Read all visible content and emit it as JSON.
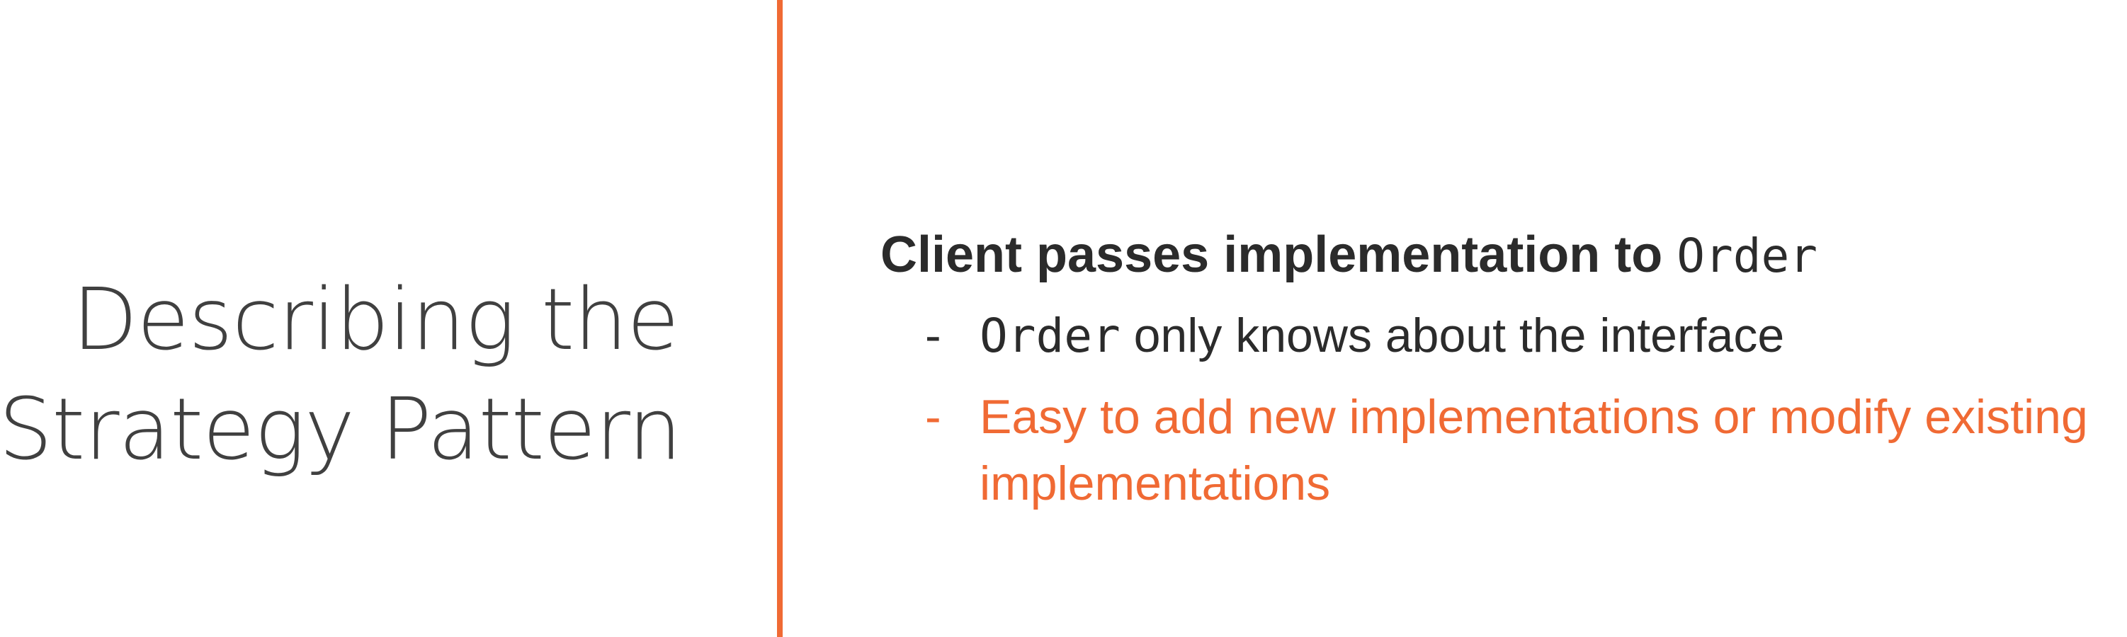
{
  "slide": {
    "title_lines": [
      "Describing the",
      "Strategy Pattern"
    ],
    "headline": {
      "text": "Client passes implementation to",
      "code": "Order"
    },
    "bullets": [
      {
        "dash": "-",
        "code": "Order",
        "text": " only knows about the interface"
      },
      {
        "dash": "-",
        "text": "Easy to add new implementations or modify existing implementations"
      }
    ]
  },
  "colors": {
    "accent": "#f06a34",
    "title_text": "#404040",
    "body_text": "#2b2b2b",
    "background": "#ffffff"
  }
}
